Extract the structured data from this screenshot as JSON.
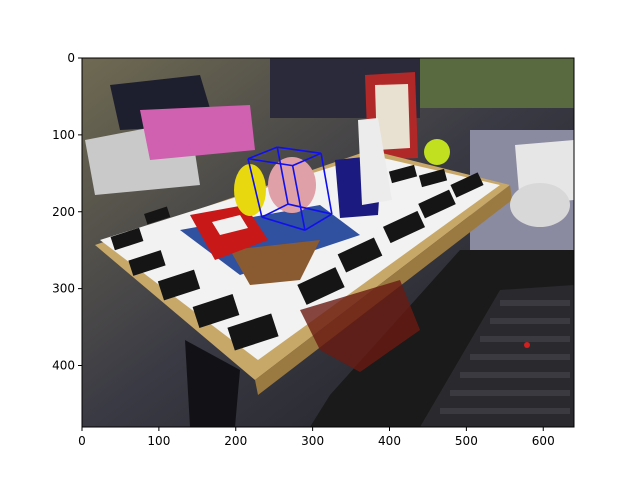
{
  "axes": {
    "xlim": [
      0,
      640
    ],
    "ylim": [
      480,
      0
    ],
    "x_ticks": [
      "0",
      "100",
      "200",
      "300",
      "400",
      "500",
      "600"
    ],
    "y_ticks": [
      "0",
      "100",
      "200",
      "300",
      "400"
    ],
    "x_tick_values": [
      0,
      100,
      200,
      300,
      400,
      500,
      600
    ],
    "y_tick_values": [
      0,
      100,
      200,
      300,
      400
    ]
  },
  "image": {
    "content": "photo",
    "scene": "cluttered table with marker board, toys, cups and laptop"
  },
  "overlay_box": {
    "color": "#1010ee",
    "hidden_edge_color": "#20a020",
    "vertices": [
      [
        216,
        131
      ],
      [
        254,
        116
      ],
      [
        311,
        124
      ],
      [
        274,
        140
      ],
      [
        234,
        207
      ],
      [
        268,
        190
      ],
      [
        325,
        203
      ],
      [
        290,
        224
      ]
    ],
    "edges": [
      [
        0,
        1
      ],
      [
        1,
        2
      ],
      [
        2,
        3
      ],
      [
        3,
        0
      ],
      [
        4,
        5
      ],
      [
        5,
        6
      ],
      [
        6,
        7
      ],
      [
        7,
        4
      ],
      [
        0,
        4
      ],
      [
        1,
        5
      ],
      [
        2,
        6
      ],
      [
        3,
        7
      ]
    ]
  }
}
